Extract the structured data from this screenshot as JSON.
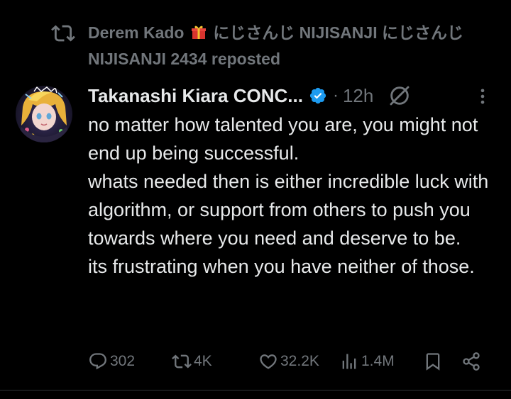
{
  "repost": {
    "prefix_name": "Derem Kado",
    "gift_icon": "gift-icon",
    "suffix_name": "にじさんじ NIJISANJI にじさんじ NIJISANJI 2434",
    "action": "reposted"
  },
  "tweet": {
    "display_name": "Takanashi Kiara CONC...",
    "verified": true,
    "separator": "·",
    "time": "12h",
    "paragraphs": [
      "no matter how talented you are, you might not end up being successful.",
      "whats needed then is either incredible luck with algorithm, or support from others to push you towards where you need and deserve to be.",
      "its frustrating when you have neither of those."
    ]
  },
  "actions": {
    "replies": "302",
    "reposts": "4K",
    "likes": "32.2K",
    "views": "1.4M"
  },
  "colors": {
    "background": "#000000",
    "text": "#e7e9ea",
    "secondary": "#71767b",
    "verified": "#1d9bf0"
  }
}
